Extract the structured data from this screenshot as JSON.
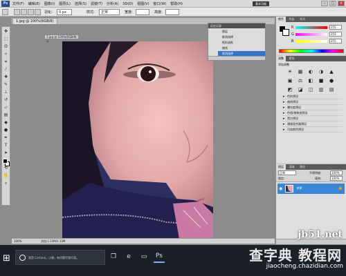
{
  "app": {
    "logo": "Ps",
    "menu": [
      "文件(F)",
      "编辑(E)",
      "图像(I)",
      "图层(L)",
      "选择(S)",
      "滤镜(T)",
      "分析(A)",
      "3D(D)",
      "视图(V)",
      "窗口(W)",
      "帮助(H)"
    ],
    "workspace_label": "基本功能",
    "window_buttons": [
      "–",
      "□",
      "×"
    ]
  },
  "options": {
    "feather_label": "羽化:",
    "feather_value": "0 px",
    "style_label": "样式:",
    "style_value": "正常",
    "width_label": "宽度:",
    "height_label": "高度:"
  },
  "document": {
    "tab_title": "1.jpg @ 100%(RGB/8)",
    "float_title": "1.jpg @ 100%(RGB/8) ×",
    "zoom": "100%",
    "status": "文档:1.13M/1.13M"
  },
  "history": {
    "title": "历史记录",
    "items": [
      {
        "label": "图层",
        "selected": false
      },
      {
        "label": "取消选择",
        "selected": false
      },
      {
        "label": "矩形选框",
        "selected": false
      },
      {
        "label": "曲线",
        "selected": false
      },
      {
        "label": "取消选择",
        "selected": true
      }
    ]
  },
  "color_panel": {
    "tabs": [
      "颜色",
      "色板",
      "样式"
    ],
    "channels": [
      {
        "name": "R",
        "value": "255",
        "color": "#ff4040"
      },
      {
        "name": "G",
        "value": "255",
        "color": "#40d040"
      },
      {
        "name": "B",
        "value": "255",
        "color": "#4060ff"
      }
    ]
  },
  "adjust_panel": {
    "tabs": [
      "调整",
      "蒙版"
    ],
    "title": "添加调整",
    "icons": [
      "☀",
      "▦",
      "◐",
      "◑",
      "▲",
      "▣",
      "⚖",
      "◧",
      "■",
      "●",
      "◩",
      "◪",
      "◫",
      "▥",
      "▤"
    ],
    "presets": [
      "色阶预设",
      "曲线预设",
      "曝光度预设",
      "色相/饱和度预设",
      "黑白预设",
      "通道混合器预设",
      "可选颜色预设"
    ]
  },
  "layers_panel": {
    "tabs": [
      "图层",
      "通道",
      "路径"
    ],
    "blend_mode": "正常",
    "opacity_label": "不透明度:",
    "opacity_value": "100%",
    "lock_label": "锁定:",
    "fill_label": "填充:",
    "fill_value": "100%",
    "layer_name": "背景",
    "layer_selected": true
  },
  "taskbar": {
    "search_text": "我是 Cortana，小娜。有问题尽管问我。",
    "active_index": 3
  },
  "watermark": {
    "line1": "jb51.net",
    "line2": "查字典 教程网",
    "line3": "jiaocheng.chazidian.com"
  }
}
